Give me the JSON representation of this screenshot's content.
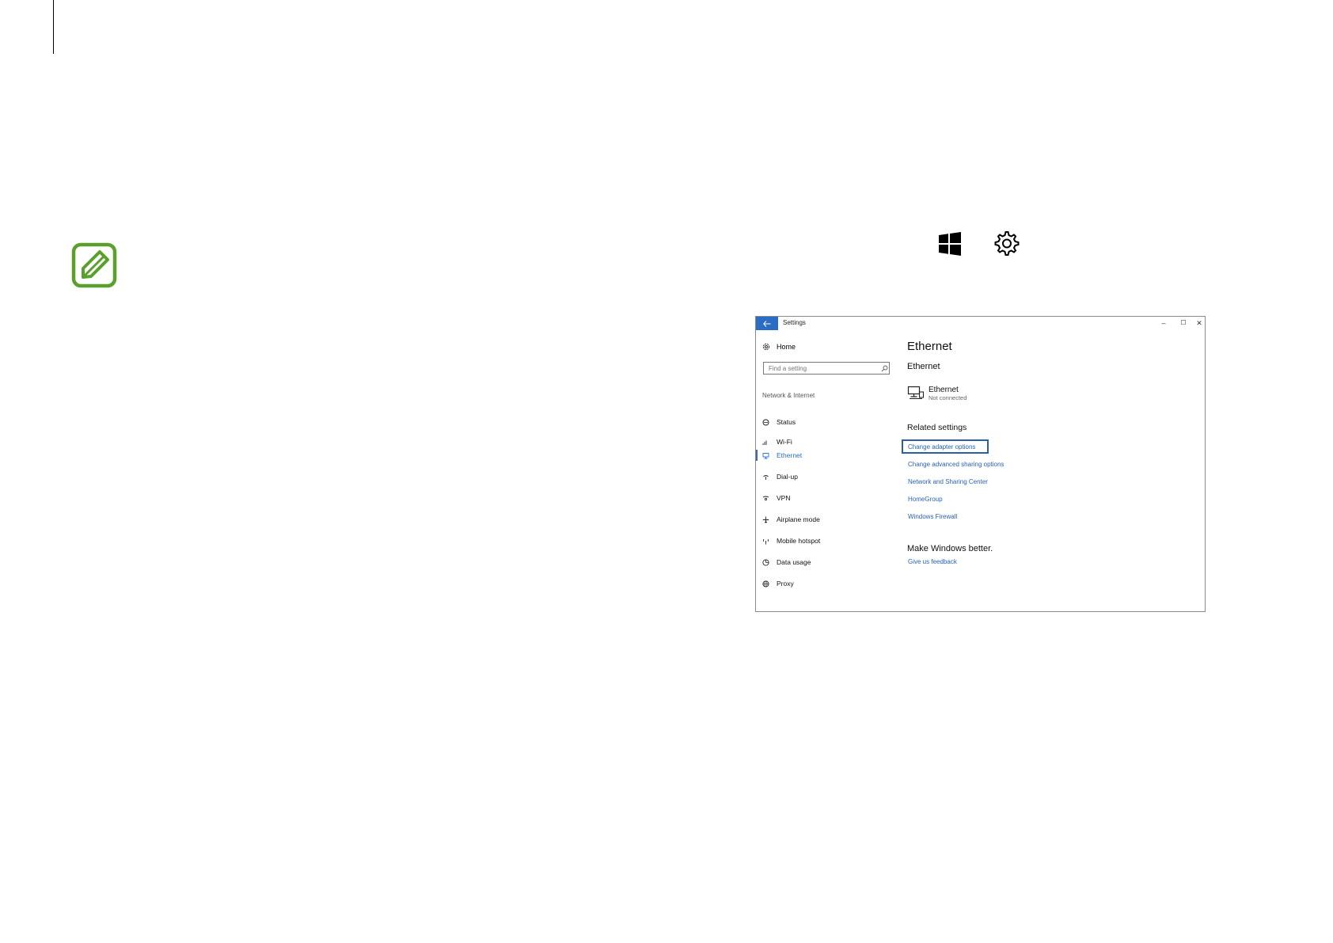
{
  "window": {
    "title": "Settings",
    "minimize": "–",
    "maximize": "☐",
    "close": "✕"
  },
  "sidebar": {
    "home": "Home",
    "search_placeholder": "Find a setting",
    "section": "Network & Internet",
    "items": [
      {
        "label": "Status",
        "icon": "status-icon"
      },
      {
        "label": "Wi-Fi",
        "icon": "wifi-icon"
      },
      {
        "label": "Ethernet",
        "icon": "ethernet-icon",
        "active": true
      },
      {
        "label": "Dial-up",
        "icon": "dialup-icon"
      },
      {
        "label": "VPN",
        "icon": "vpn-icon"
      },
      {
        "label": "Airplane mode",
        "icon": "airplane-icon"
      },
      {
        "label": "Mobile hotspot",
        "icon": "hotspot-icon"
      },
      {
        "label": "Data usage",
        "icon": "data-usage-icon"
      },
      {
        "label": "Proxy",
        "icon": "globe-icon"
      }
    ]
  },
  "main": {
    "page_title": "Ethernet",
    "section_title": "Ethernet",
    "adapter": {
      "name": "Ethernet",
      "status": "Not connected"
    },
    "related_title": "Related settings",
    "links": [
      "Change adapter options",
      "Change advanced sharing options",
      "Network and Sharing Center",
      "HomeGroup",
      "Windows Firewall"
    ],
    "feedback_title": "Make Windows better.",
    "feedback_link": "Give us feedback"
  },
  "colors": {
    "accent": "#2b6cc4",
    "link": "#2563b8",
    "note_green": "#5aa02c"
  }
}
